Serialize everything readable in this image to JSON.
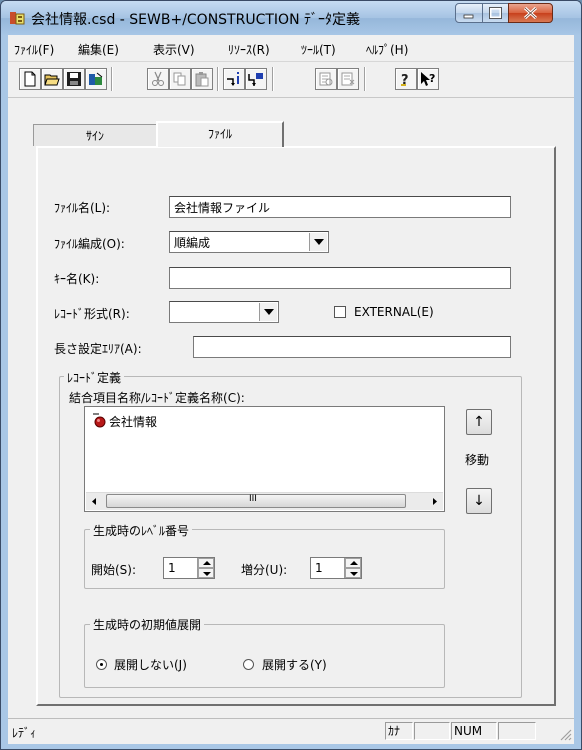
{
  "window": {
    "title": "会社情報.csd - SEWB+/CONSTRUCTION ﾃﾞｰﾀ定義"
  },
  "menu": [
    {
      "label": "ﾌｧｲﾙ(F)"
    },
    {
      "label": "編集(E)"
    },
    {
      "label": "表示(V)"
    },
    {
      "label": "ﾘｿｰｽ(R)"
    },
    {
      "label": "ﾂｰﾙ(T)"
    },
    {
      "label": "ﾍﾙﾌﾟ(H)"
    }
  ],
  "toolbar": {
    "icons": [
      "new-file-icon",
      "open-folder-icon",
      "save-icon",
      "properties-icon",
      "cut-icon",
      "copy-icon",
      "paste-icon",
      "insert-item-icon",
      "delete-item-icon",
      "expand-icon",
      "collapse-icon",
      "help-icon",
      "context-help-icon"
    ]
  },
  "tabs": [
    {
      "label": "ｻｲﾝ",
      "active": false
    },
    {
      "label": "ﾌｧｲﾙ",
      "active": true
    }
  ],
  "form": {
    "file_name": {
      "label": "ﾌｧｲﾙ名(L):",
      "value": "会社情報ファイル"
    },
    "file_org": {
      "label": "ﾌｧｲﾙ編成(O):",
      "value": "順編成"
    },
    "key_name": {
      "label": "ｷｰ名(K):",
      "value": ""
    },
    "record_format": {
      "label": "ﾚｺｰﾄﾞ形式(R):",
      "value": ""
    },
    "external": {
      "label": "EXTERNAL(E)",
      "checked": false
    },
    "length_area": {
      "label": "長さ設定ｴﾘｱ(A):",
      "value": ""
    }
  },
  "record_def": {
    "group_title": "ﾚｺｰﾄﾞ定義",
    "list_label": "結合項目名称/ﾚｺｰﾄﾞ定義名称(C):",
    "items": [
      "会社情報"
    ],
    "up_button": "↑",
    "down_button": "↓",
    "move_label": "移動",
    "scroll_grip": "III"
  },
  "level": {
    "group_title": "生成時のﾚﾍﾞﾙ番号",
    "start_label": "開始(S):",
    "start_value": "1",
    "step_label": "増分(U):",
    "step_value": "1"
  },
  "initial": {
    "group_title": "生成時の初期値展開",
    "option_no": "展開しない(J)",
    "option_yes": "展開する(Y)",
    "selected": "no"
  },
  "status": {
    "text": "ﾚﾃﾞｨ",
    "kana": "ｶﾅ",
    "num": "NUM"
  },
  "colors": {
    "titlebar": "#a5c3e3",
    "close_button": "#c7401c",
    "face": "#f0f0f0"
  }
}
